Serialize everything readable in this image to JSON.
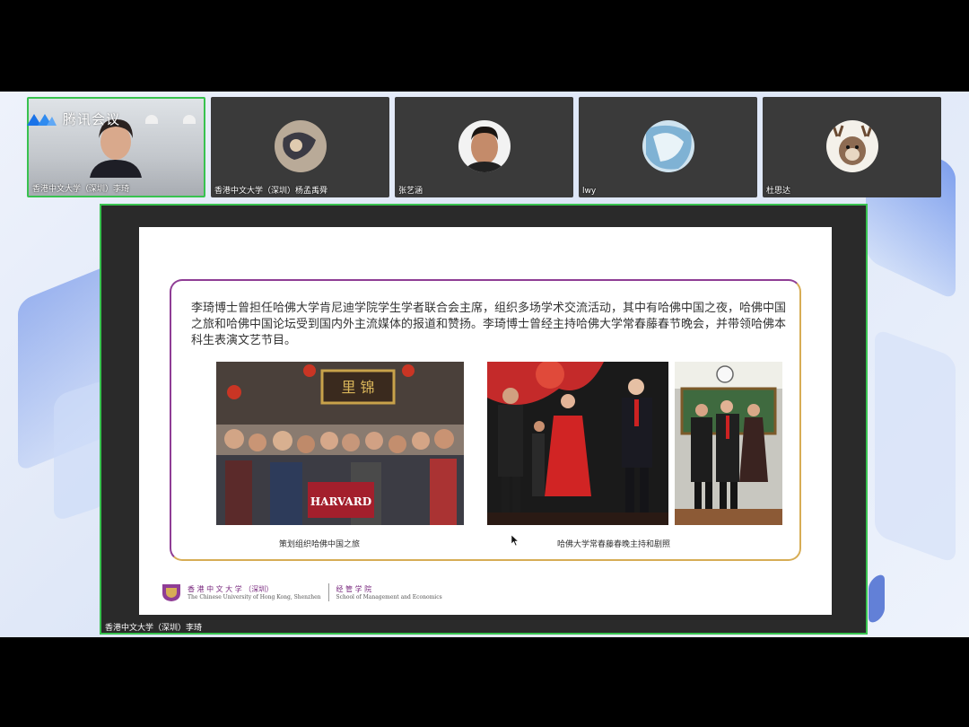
{
  "app": {
    "logo_text": "腾讯会议"
  },
  "participants": [
    {
      "name": "香港中文大学（深圳）李琦"
    },
    {
      "name": "香港中文大学（深圳）杨孟禹舜"
    },
    {
      "name": "张艺涵"
    },
    {
      "name": "lwy"
    },
    {
      "name": "杜思达"
    }
  ],
  "screen_share": {
    "sharer": "香港中文大学（深圳）李琦",
    "slide": {
      "text": "李琦博士曾担任哈佛大学肯尼迪学院学生学者联合会主席，组织多场学术交流活动，其中有哈佛中国之夜，哈佛中国之旅和哈佛中国论坛受到国内外主流媒体的报道和赞扬。李琦博士曾经主持哈佛大学常春藤春节晚会，并带领哈佛本科生表演文艺节目。",
      "photo1_sign": "里 锦",
      "photo1_banner": "HARVARD",
      "caption_left": "策划组织哈佛中国之旅",
      "caption_right": "哈佛大学常春藤春晚主持和剧照",
      "footer": {
        "school_cn": "香 港 中 文 大 学 （深圳）",
        "school_en": "The Chinese University of Hong Kong, Shenzhen",
        "dept_cn": "经 管 学 院",
        "dept_en": "School of Management and Economics"
      }
    }
  },
  "colors": {
    "active_border": "#38c24f",
    "accent_purple": "#8f3d95",
    "accent_gold": "#d7ad55"
  }
}
